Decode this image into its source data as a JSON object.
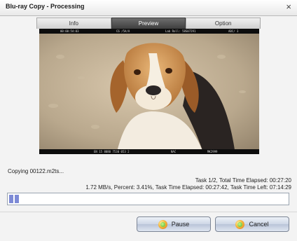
{
  "window": {
    "title": "Blu-ray Copy  -  Processing",
    "close_glyph": "×"
  },
  "tabs": [
    {
      "label": "Info"
    },
    {
      "label": "Preview"
    },
    {
      "label": "Option"
    }
  ],
  "preview": {
    "hud_top": [
      "00:00:54:03",
      "C6 /5A/A",
      "Lab Roll: 58S07291",
      "ABC/ 3"
    ],
    "hud_bottom": [
      "EN 15 8080 7530 053 2",
      "NAC",
      "MK2999"
    ]
  },
  "status": {
    "copying": "Copying 00122.m2ts...",
    "task_line": "Task 1/2,  Total Time Elapsed: 00:27:20",
    "stats_line": "1.72 MB/s,  Percent: 3.41%,  Task Time Elapsed: 00:27:42,  Task Time Left: 07:14:29",
    "progress_percent": 3.41
  },
  "buttons": {
    "pause": "Pause",
    "cancel": "Cancel"
  },
  "colors": {
    "progress_fill": "#7d8ad6",
    "active_tab": "#4a4a4a"
  },
  "icons": {
    "button_icon": "green-play-circle-icon",
    "close": "close-icon"
  }
}
